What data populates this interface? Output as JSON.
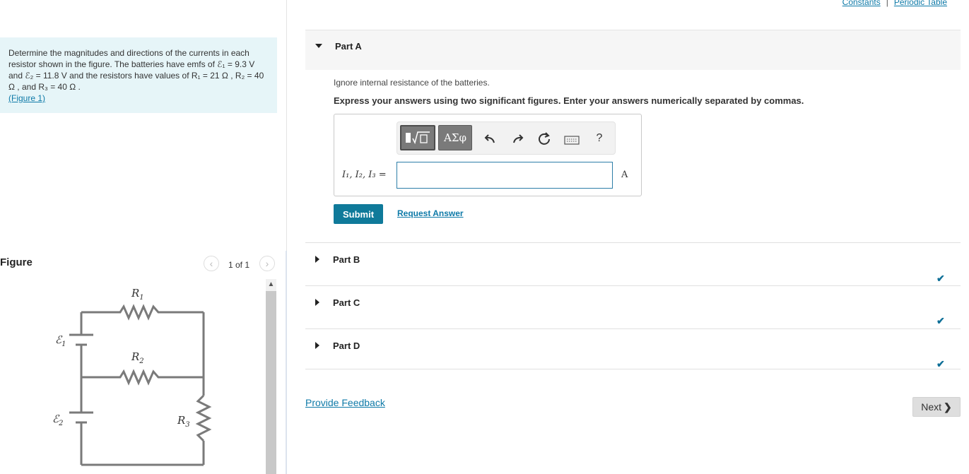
{
  "top_links": {
    "constants": "Constants",
    "separator": "|",
    "periodic_table": "Periodic Table"
  },
  "problem": {
    "text": "Determine the magnitudes and directions of the currents in each resistor shown in the figure. The batteries have emfs of ℰ₁ = 9.3 V and ℰ₂ = 11.8 V and the resistors have values of R₁ = 21 Ω , R₂ = 40 Ω , and R₃ = 40 Ω .",
    "figure_link": "(Figure 1)"
  },
  "figure": {
    "title": "Figure",
    "pager_text": "1 of 1",
    "labels": {
      "r1": "R",
      "r1_sub": "1",
      "r2": "R",
      "r2_sub": "2",
      "r3": "R",
      "r3_sub": "3",
      "e1": "ℰ",
      "e1_sub": "1",
      "e2": "ℰ",
      "e2_sub": "2"
    }
  },
  "part_a": {
    "label": "Part A",
    "instruction1": "Ignore internal resistance of the batteries.",
    "instruction2": "Express your answers using two significant figures. Enter your answers numerically separated by commas.",
    "toolbar": {
      "greek_label": "ΑΣφ",
      "help_label": "?"
    },
    "answer_label": "I₁, I₂, I₃ =",
    "answer_value": "",
    "unit": "A",
    "submit_label": "Submit",
    "request_label": "Request Answer"
  },
  "parts": [
    {
      "label": "Part B",
      "status": "complete"
    },
    {
      "label": "Part C",
      "status": "complete"
    },
    {
      "label": "Part D",
      "status": "complete"
    }
  ],
  "footer": {
    "feedback_label": "Provide Feedback",
    "next_label": "Next"
  },
  "colors": {
    "accent": "#0f7a9a",
    "problem_bg": "#e6f5f8",
    "check": "#0e6f97",
    "circuit": "#7a7a7a"
  }
}
